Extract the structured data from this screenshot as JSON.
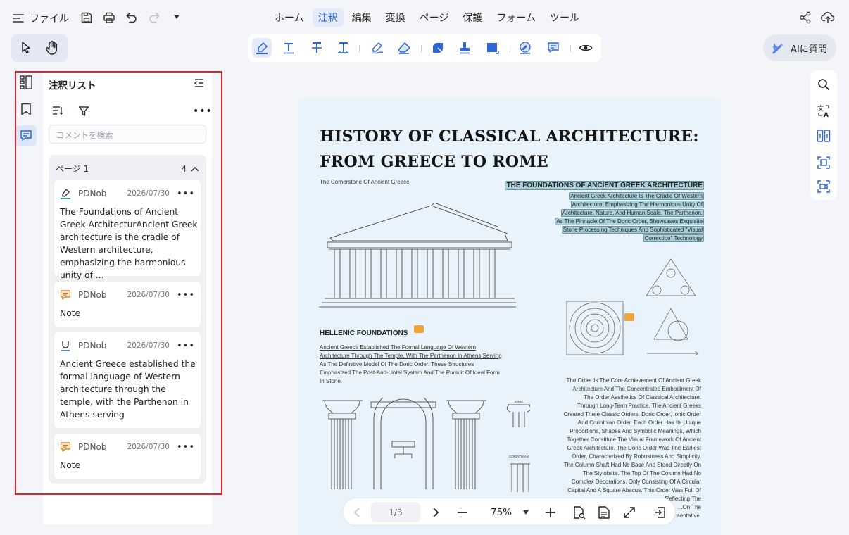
{
  "menubar": {
    "file_label": "ファイル",
    "tabs": [
      {
        "label": "ホーム",
        "active": false
      },
      {
        "label": "注釈",
        "active": true
      },
      {
        "label": "編集",
        "active": false
      },
      {
        "label": "変換",
        "active": false
      },
      {
        "label": "ページ",
        "active": false
      },
      {
        "label": "保護",
        "active": false
      },
      {
        "label": "フォーム",
        "active": false
      },
      {
        "label": "ツール",
        "active": false
      }
    ]
  },
  "ai_button": {
    "label": "AIに質問"
  },
  "colors": {
    "accent": "#2f65d9",
    "highlight_border": "#e02430",
    "highlight_fill": "#a9cfd9",
    "note": "#f1a33c"
  },
  "panel": {
    "title": "注釈リスト",
    "search_placeholder": "コメントを検索",
    "group": {
      "label": "ページ 1",
      "count": "4"
    },
    "comments": [
      {
        "icon": "highlight-icon",
        "author": "PDNob",
        "date": "2026/07/30",
        "text": "The Foundations of Ancient Greek ArchitecturAncient Greek architecture is the cradle of Western architecture, emphasizing the harmonious unity of ..."
      },
      {
        "icon": "note-icon",
        "author": "PDNob",
        "date": "2026/07/30",
        "text": "Note"
      },
      {
        "icon": "underline-icon",
        "author": "PDNob",
        "date": "2026/07/30",
        "text": "Ancient Greece established the formal language of Western architecture through the temple, with the Parthenon in Athens serving"
      },
      {
        "icon": "note-icon",
        "author": "PDNob",
        "date": "2026/07/30",
        "text": "Note"
      }
    ]
  },
  "document": {
    "title_line1": "HISTORY OF CLASSICAL  ARCHITECTURE:",
    "title_line2": "FROM GREECE TO ROME",
    "subtitle": "The Cornerstone Of Ancient Greece",
    "hl_heading": "THE FOUNDATIONS OF ANCIENT GREEK ARCHITECTURE",
    "hl_lines": [
      "Ancient Greek Architecture Is The Cradle Of Western",
      "Architecture, Emphasizing The Harmonious Unity Of",
      "Architecture, Nature, And Human Scale. The Parthenon,",
      "As The Pinnacle Of The Doric Order, Showcases Exquisite",
      "Stone Processing Techniques And Sophisticated \"Visual",
      "Correction\" Technology"
    ],
    "section_heading": "HELLENIC FOUNDATIONS",
    "section_underlined": [
      "Ancient Greece Established The Formal Language Of Western",
      "Architecture Through The Temple, With The Parthenon In Athens Serving"
    ],
    "section_body": [
      "As The Definitive Model Of The Doric Order. These Structures",
      "Emphasized The Post-And-Lintel System And The Pursuit Of Ideal Form",
      "In Stone."
    ],
    "ionic_label": "IONIC",
    "corinthian_label": "CORINTHIAN",
    "order_paragraph": [
      "The Order Is The Core Achievement Of Ancient Greek",
      "Architecture And The Concentrated Embodiment Of",
      "The Order Aesthetics Of Classical Architecture.",
      "Through Long-Term Practice, The Ancient Greeks",
      "Created Three Classic Orders: Doric Order, Ionic Order",
      "And Corinthian Order. Each Order Has Its Unique",
      "Proportions, Shapes And Symbolic Meanings, Which",
      "Together Constitute The Visual Framework Of Ancient",
      "Greek Architecture. The Doric Order Was The Earliest",
      "Order, Characterized By Robustness And Simplicity.",
      "The Column Shaft Had No Base And Stood Directly On",
      "The Stylobate. The Top Of The Column Had No",
      "Complex Decorations, Only Consisting Of A Circular",
      "Capital And A Square Abacus. This Order Was Full Of",
      "...Reflecting The",
      "...On The",
      "...sentative."
    ]
  },
  "bottom_bar": {
    "page": "1/3",
    "zoom": "75%"
  }
}
